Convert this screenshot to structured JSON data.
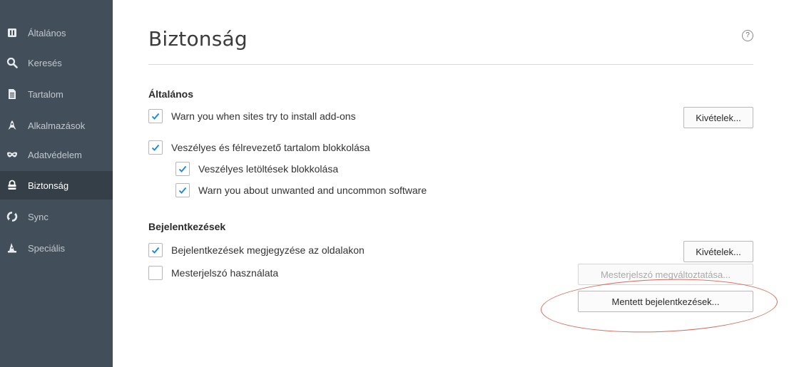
{
  "sidebar": {
    "items": [
      {
        "label": "Általános",
        "icon": "general-icon"
      },
      {
        "label": "Keresés",
        "icon": "search-icon"
      },
      {
        "label": "Tartalom",
        "icon": "document-icon"
      },
      {
        "label": "Alkalmazások",
        "icon": "rocket-icon"
      },
      {
        "label": "Adatvédelem",
        "icon": "mask-icon"
      },
      {
        "label": "Biztonság",
        "icon": "lock-icon",
        "selected": true
      },
      {
        "label": "Sync",
        "icon": "sync-icon"
      },
      {
        "label": "Speciális",
        "icon": "wizard-hat-icon"
      }
    ]
  },
  "main": {
    "title": "Biztonság",
    "help_glyph": "?",
    "general": {
      "heading": "Általános",
      "warn_addons": {
        "label": "Warn you when sites try to install add-ons",
        "checked": true
      },
      "exceptions_button": "Kivételek...",
      "block_dangerous": {
        "label": "Veszélyes és félrevezető tartalom blokkolása",
        "checked": true
      },
      "block_downloads": {
        "label": "Veszélyes letöltések blokkolása",
        "checked": true
      },
      "warn_unwanted": {
        "label": "Warn you about unwanted and uncommon software",
        "checked": true
      }
    },
    "logins": {
      "heading": "Bejelentkezések",
      "remember": {
        "label": "Bejelentkezések megjegyzése az oldalakon",
        "checked": true
      },
      "exceptions_button": "Kivételek...",
      "master_password": {
        "label": "Mesterjelszó használata",
        "checked": false
      },
      "change_master_button": "Mesterjelszó megváltoztatása...",
      "saved_logins_button": "Mentett bejelentkezések..."
    }
  },
  "colors": {
    "sidebar_bg": "#424f5a",
    "sidebar_selected": "#343f48",
    "check_blue": "#0a84ff",
    "annotation_red": "#d9685a"
  }
}
